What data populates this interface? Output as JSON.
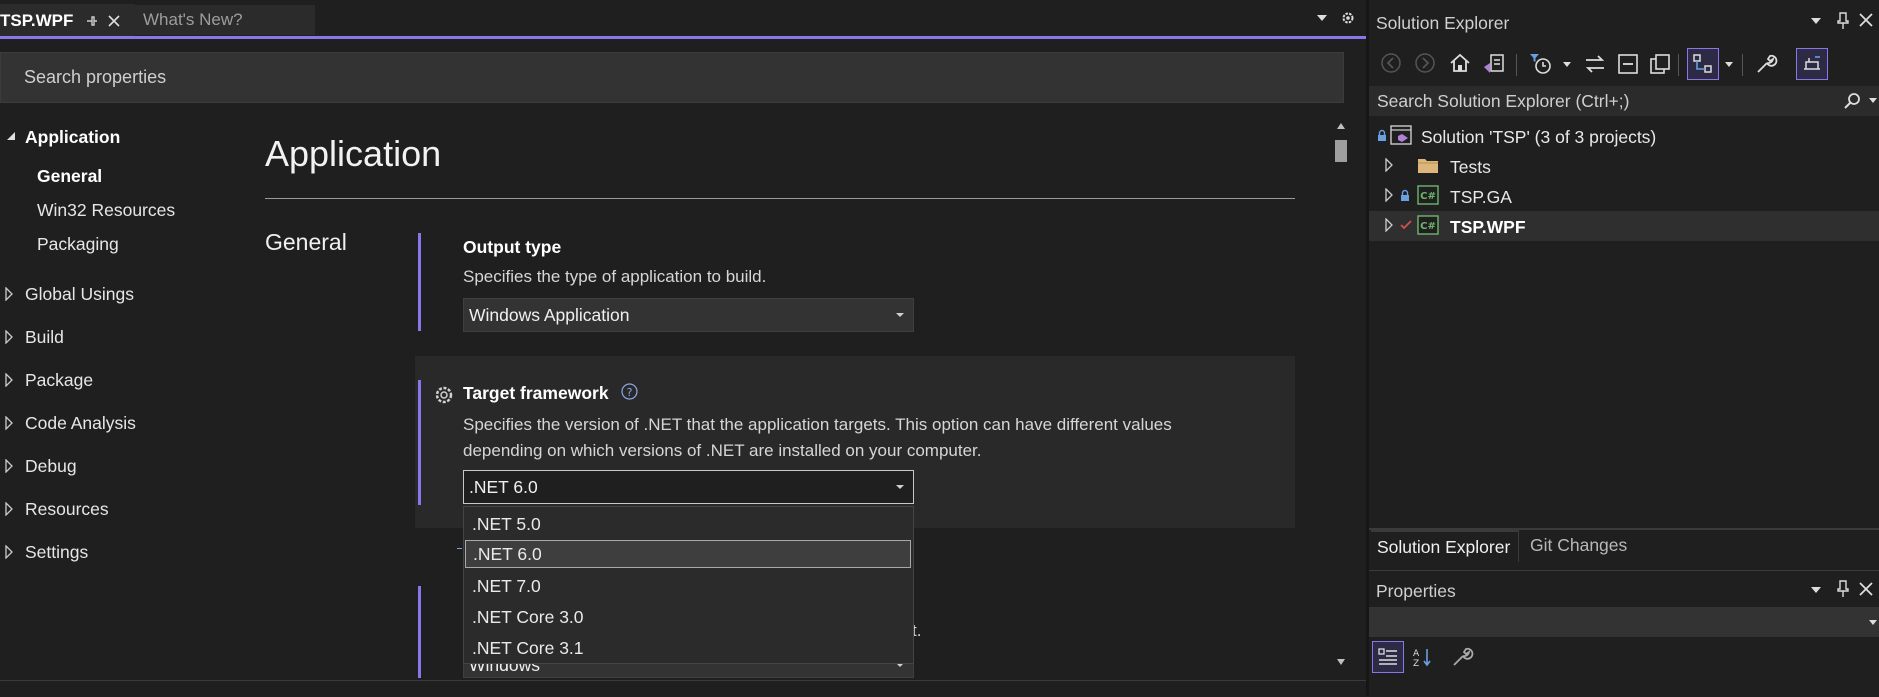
{
  "tabs": {
    "active": "TSP.WPF",
    "inactive": "What's New?"
  },
  "search": {
    "placeholder": "Search properties"
  },
  "nav": {
    "application": "Application",
    "general": "General",
    "win32": "Win32 Resources",
    "packaging": "Packaging",
    "global_usings": "Global Usings",
    "build": "Build",
    "package": "Package",
    "code_analysis": "Code Analysis",
    "debug": "Debug",
    "resources": "Resources",
    "settings": "Settings"
  },
  "main": {
    "page_title": "Application",
    "section_title": "General",
    "output_type": {
      "title": "Output type",
      "description": "Specifies the type of application to build.",
      "value": "Windows Application"
    },
    "target_framework": {
      "title": "Target framework",
      "description_line1": "Specifies the version of .NET that the application targets. This option can have different values",
      "description_line2": "depending on which versions of .NET are installed on your computer.",
      "value": ".NET 6.0",
      "options": [
        ".NET 5.0",
        ".NET 6.0",
        ".NET 7.0",
        ".NET Core 3.0",
        ".NET Core 3.1"
      ],
      "selected_index": 1
    },
    "partial_below": {
      "value": "Windows",
      "fragment": "t."
    }
  },
  "solution_explorer": {
    "title": "Solution Explorer",
    "search_placeholder": "Search Solution Explorer (Ctrl+;)",
    "items": [
      {
        "label": "Solution 'TSP' (3 of 3 projects)",
        "icon": "solution-icon"
      },
      {
        "label": "Tests",
        "icon": "folder-icon"
      },
      {
        "label": "TSP.GA",
        "icon": "csharp-project-icon"
      },
      {
        "label": "TSP.WPF",
        "icon": "csharp-project-icon"
      }
    ],
    "bottom_tabs": [
      "Solution Explorer",
      "Git Changes"
    ]
  },
  "properties_pane": {
    "title": "Properties"
  },
  "colors": {
    "accent": "#8a76e8",
    "background": "#1f1f1f",
    "folder": "#dcb67a",
    "csharp_icon": "#6fb56d"
  }
}
